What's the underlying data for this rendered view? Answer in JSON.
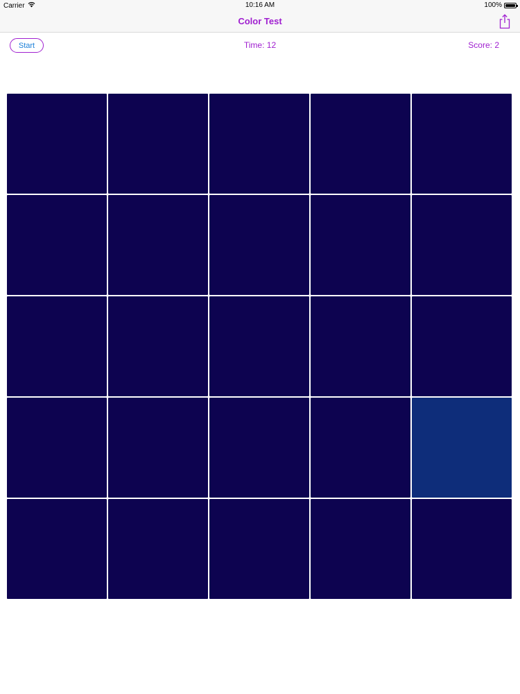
{
  "status_bar": {
    "carrier": "Carrier",
    "time": "10:16 AM",
    "battery": "100%",
    "battery_level": 1.0
  },
  "nav": {
    "title": "Color Test",
    "share_icon": "share-icon"
  },
  "toolbar": {
    "start_label": "Start",
    "time_label": "Time: 12",
    "score_label": "Score: 2"
  },
  "colors": {
    "accent": "#a020d0",
    "button_text": "#1a7fd8",
    "tile_base": "#0d0350",
    "tile_odd": "#0e2d7a"
  },
  "grid": {
    "rows": 5,
    "cols": 5,
    "odd_tile": {
      "row": 3,
      "col": 4
    }
  }
}
